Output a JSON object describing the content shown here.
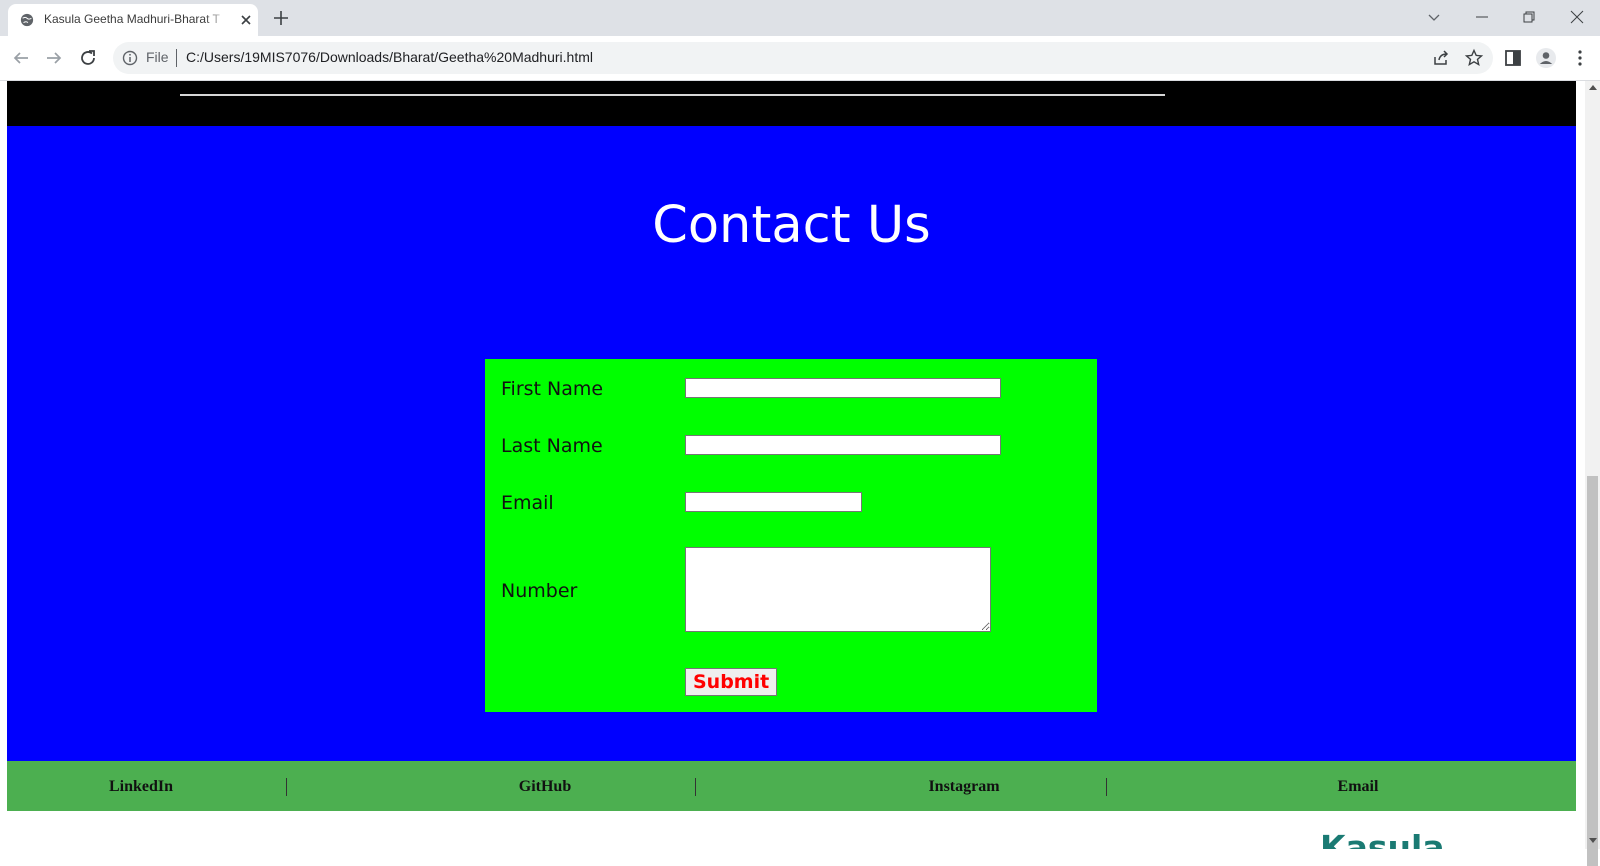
{
  "browser": {
    "tab_title": "Kasula Geetha Madhuri-Bharat T",
    "omnibox_scheme": "File",
    "url": "C:/Users/19MIS7076/Downloads/Bharat/Geetha%20Madhuri.html",
    "icons": [
      "globe-icon",
      "close-icon",
      "plus-icon",
      "chevron-down-icon",
      "minimize-icon",
      "restore-icon",
      "window-close-icon",
      "back-arrow-icon",
      "forward-arrow-icon",
      "reload-icon",
      "info-icon",
      "share-icon",
      "star-icon",
      "side-panel-icon",
      "profile-icon",
      "kebab-menu-icon"
    ]
  },
  "page": {
    "contact_heading": "Contact Us",
    "form": {
      "first_name_label": "First Name",
      "last_name_label": "Last Name",
      "email_label": "Email",
      "number_label": "Number",
      "first_name_value": "",
      "last_name_value": "",
      "email_value": "",
      "number_value": "",
      "submit_label": "Submit"
    },
    "footer_links": [
      "LinkedIn",
      "GitHub",
      "Instagram",
      "Email"
    ],
    "brand_text": "Kasula"
  },
  "colors": {
    "contact_bg": "#0000ff",
    "form_bg": "#00ff00",
    "footer_bg": "#4caf50",
    "submit_text": "#ff0000",
    "top_band": "#000000",
    "brand_text": "#1a7a73"
  }
}
